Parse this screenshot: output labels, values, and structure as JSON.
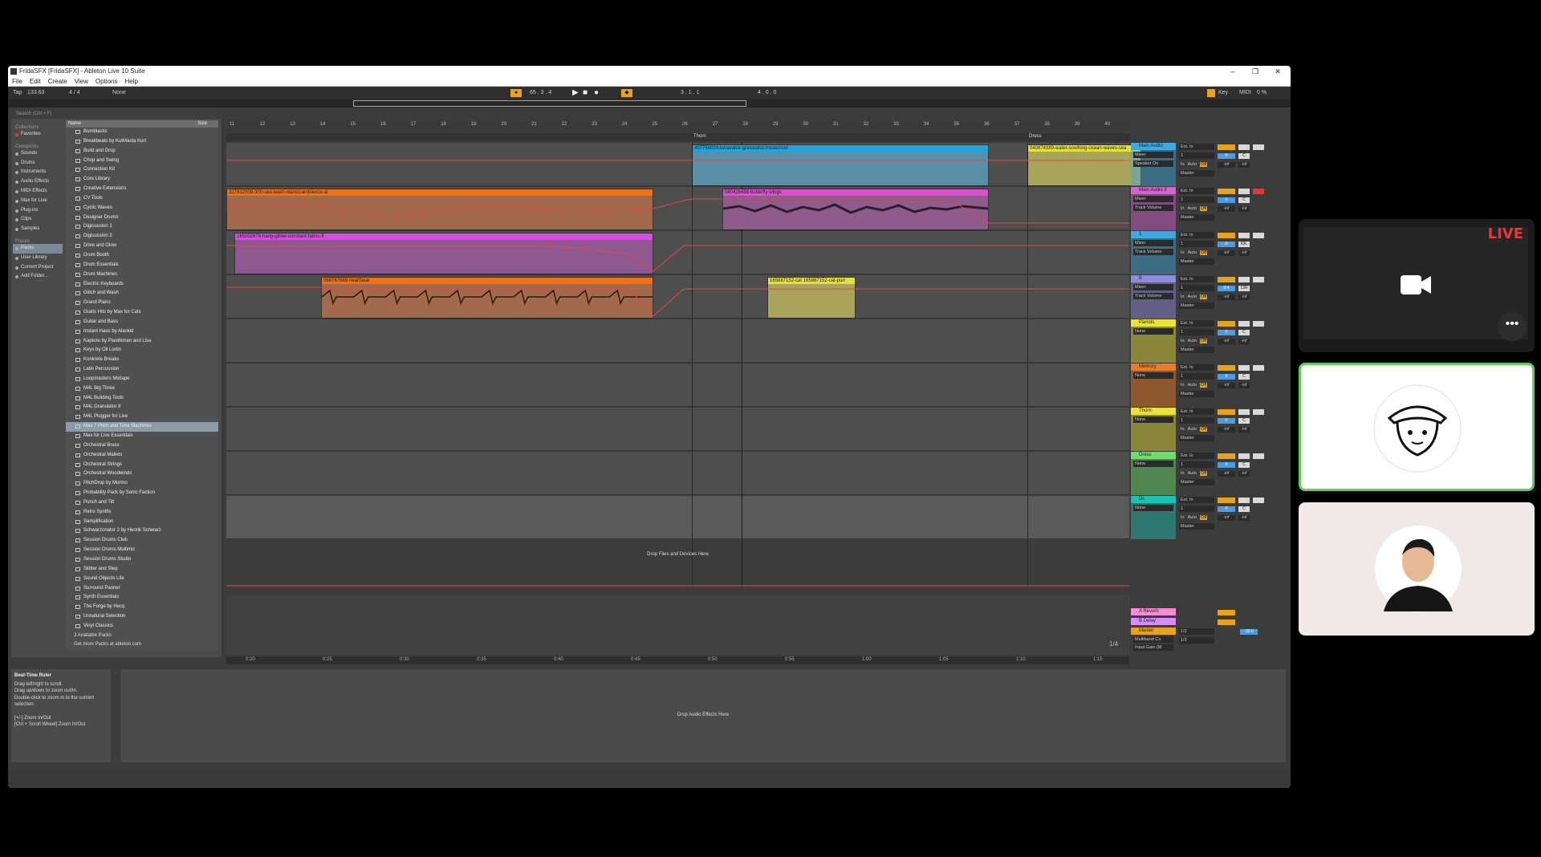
{
  "window": {
    "title": "FridaSFX [FridaSFX] - Ableton Live 10 Suite",
    "minimize": "–",
    "maximize": "❐",
    "close": "✕"
  },
  "menu": [
    "File",
    "Edit",
    "Create",
    "View",
    "Options",
    "Help"
  ],
  "control": {
    "tap": "Tap",
    "tempo": "133.63",
    "meter": "4 / 4",
    "quant": "None",
    "position": "65 . 3 . 4",
    "loop_start": "3 . 1 . 1",
    "loop_len": "4 . 0 . 0",
    "key": "Key",
    "midi": "MIDI",
    "cpu": "0 %"
  },
  "browser": {
    "search_placeholder": "Search (Ctrl + F)",
    "collections_label": "Collections",
    "favorites": "Favorites",
    "categories_label": "Categories",
    "categories": [
      "Sounds",
      "Drums",
      "Instruments",
      "Audio Effects",
      "MIDI Effects",
      "Max for Live",
      "Plug-ins",
      "Clips",
      "Samples"
    ],
    "places_label": "Places",
    "places": [
      "Packs",
      "User Library",
      "Current Project",
      "Add Folder..."
    ],
    "col_name": "Name",
    "col_size": "Size",
    "items": [
      "Bombtastic",
      "Breakbeats by KutMasta Kurt",
      "Build and Drop",
      "Chop and Swing",
      "Connection Kit",
      "Core Library",
      "Creative Extensions",
      "CV Tools",
      "Cyclic Waves",
      "Designer Drums",
      "Digicussion 1",
      "Digicussion 2",
      "Drive and Glow",
      "Drum Booth",
      "Drum Essentials",
      "Drum Machines",
      "Electric Keyboards",
      "Glitch and Wash",
      "Grand Piano",
      "Gratis Hits by Max for Cats",
      "Guitar and Bass",
      "Instant Haus by Alaskid",
      "Kapture by Plastikman and Lisa",
      "Keys by Oli Lortin",
      "Konkrete Breaks",
      "Latin Percussion",
      "Loopmasters Mixtape",
      "M4L Big Three",
      "M4L Building Tools",
      "M4L Granulator II",
      "M4L Plugger for Live",
      "Max 7 Pitch and Time Machines",
      "Max for Live Essentials",
      "Orchestral Brass",
      "Orchestral Mallets",
      "Orchestral Strings",
      "Orchestral Woodwinds",
      "PitchDrop by Mormo",
      "Probability Pack by Sonic Faction",
      "Punch and Tilt",
      "Retro Synths",
      "Samplification",
      "Schwarzonator 2 by Henrik Schwarz",
      "Session Drums Club",
      "Session Drums Multimic",
      "Session Drums Studio",
      "Skitter and Step",
      "Sound Objects Lite",
      "Surround Panner",
      "Synth Essentials",
      "The Forge by Hecq",
      "Unnatural Selection",
      "Vinyl Classics"
    ],
    "selected_item": "Max 7 Pitch and Time Machines",
    "available": "3 Available Packs",
    "more_packs": "Get more Packs at ableton.com"
  },
  "info": {
    "title": "Beat-Time Ruler",
    "lines": [
      "Drag left/right to scroll.",
      "Drag up/down to zoom out/in.",
      "Double-click to zoom in to the current selection.",
      "",
      "[+/-] Zoom In/Out",
      "[Ctrl + Scroll Wheel] Zoom In/Out"
    ]
  },
  "arrangement": {
    "bars": [
      "11",
      "12",
      "13",
      "14",
      "15",
      "16",
      "17",
      "18",
      "19",
      "20",
      "21",
      "22",
      "23",
      "24",
      "25",
      "26",
      "27",
      "28",
      "29",
      "30",
      "31",
      "32",
      "33",
      "34",
      "35",
      "36",
      "37",
      "38",
      "39",
      "40"
    ],
    "locators": [
      "Thorn",
      "Dress"
    ],
    "times": [
      "0:20",
      "0:25",
      "0:30",
      "0:35",
      "0:40",
      "0:45",
      "0:50",
      "0:55",
      "1:00",
      "1:05",
      "1:10",
      "1:15"
    ],
    "drop_files": "Drop Files and Devices Here",
    "zoom_label": "1/4",
    "clips": [
      {
        "label": "407756024-keravalve-grasswind-movecrust",
        "color": "#1fa4e0",
        "body": "#5b8fa8"
      },
      {
        "label": "040674389-water-soothing-ocean-waves-sea",
        "color": "#e6e036",
        "body": "#a9a45b"
      },
      {
        "label": "327912008-300-sea-wash-waves-ambience-al",
        "color": "#f07014",
        "body": "#a26a4a"
      },
      {
        "label": "040426498-butterfly-wings",
        "color": "#d94fd0",
        "body": "#8f5a8c"
      },
      {
        "label": "165002678-hang-glider-constant-fabric-fl",
        "color": "#d64fdd",
        "body": "#8d5990"
      },
      {
        "label": "068767689-heartbeat",
        "color": "#f07014",
        "body": "#a26a4a"
      },
      {
        "label": "165887152-cat 165887152-cat-purr",
        "color": "#e6e036",
        "body": "#a9a45b"
      }
    ]
  },
  "mixer": {
    "tracks": [
      {
        "name": "Main Audio",
        "color": "#3fa8dd",
        "sel1": "Mixer",
        "sel2": "Speaker On",
        "vol": "0",
        "pan": "C"
      },
      {
        "name": "Main Audio 2",
        "color": "#d85fd4",
        "sel1": "Mixer",
        "sel2": "Track Volume",
        "vol": "0",
        "pan": "C"
      },
      {
        "name": "1",
        "color": "#3fa8dd",
        "sel1": "Mixer",
        "sel2": "Track Volume",
        "vol": "0",
        "pan": "63L"
      },
      {
        "name": "8",
        "color": "#8d8ae0",
        "sel1": "Mixer",
        "sel2": "Track Volume",
        "vol": "0.4",
        "pan": "13R"
      },
      {
        "name": "Parrots",
        "color": "#e8e23a",
        "sel1": "None",
        "sel2": "",
        "vol": "0",
        "pan": "C"
      },
      {
        "name": "Memory",
        "color": "#f07a1e",
        "sel1": "None",
        "sel2": "",
        "vol": "0",
        "pan": "C"
      },
      {
        "name": "Thorn",
        "color": "#e8e23a",
        "sel1": "None",
        "sel2": "",
        "vol": "0",
        "pan": "C"
      },
      {
        "name": "Dress",
        "color": "#6ae06a",
        "sel1": "None",
        "sel2": "",
        "vol": "0",
        "pan": "C"
      },
      {
        "name": "Dr.",
        "color": "#1ec2b4",
        "sel1": "None",
        "sel2": "",
        "vol": "0",
        "pan": "C"
      }
    ],
    "input": "Ext. In",
    "channel": "1",
    "monitor_in": "In",
    "monitor_auto": "Auto",
    "monitor_off": "Off",
    "output": "Master",
    "neg_inf": "-inf",
    "returns": [
      {
        "name": "A Reverb",
        "color": "#ff8ad6"
      },
      {
        "name": "B Delay",
        "color": "#d78dff"
      }
    ],
    "master": {
      "name": "Master",
      "device": "Multiband Co",
      "param": "Input Gain (M",
      "cue": "1/2",
      "vol": "-30.0"
    },
    "set_label": "Set"
  },
  "devices_drop": "Drop Audio Effects Here",
  "video": {
    "live_badge": "LIVE",
    "more": "•••"
  }
}
